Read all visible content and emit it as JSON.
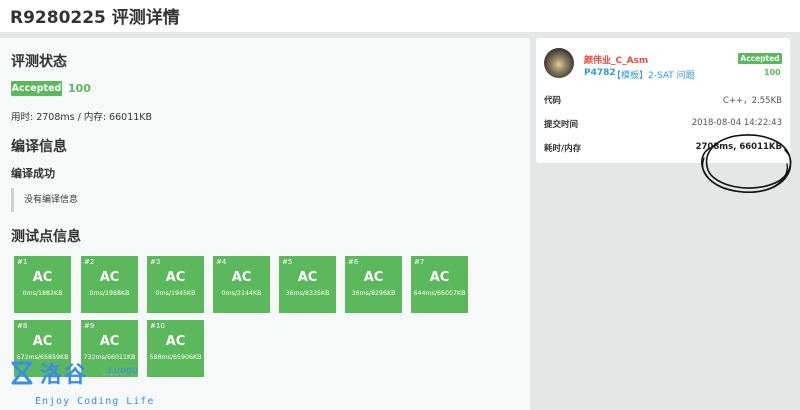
{
  "page": {
    "title": "R9280225 评测详情"
  },
  "status_section": {
    "title": "评测状态",
    "badge": "Accepted",
    "score": "100",
    "usage": "用时: 2708ms / 内存: 66011KB"
  },
  "compile_section": {
    "title": "编译信息",
    "status": "编译成功",
    "message": "没有编译信息"
  },
  "testcase_section": {
    "title": "测试点信息",
    "cases": [
      {
        "idx": "#1",
        "result": "AC",
        "meta": "0ms/1882KB"
      },
      {
        "idx": "#2",
        "result": "AC",
        "meta": "0ms/1988KB"
      },
      {
        "idx": "#3",
        "result": "AC",
        "meta": "0ms/1945KB"
      },
      {
        "idx": "#4",
        "result": "AC",
        "meta": "0ms/2144KB"
      },
      {
        "idx": "#5",
        "result": "AC",
        "meta": "36ms/8335KB"
      },
      {
        "idx": "#6",
        "result": "AC",
        "meta": "36ms/8296KB"
      },
      {
        "idx": "#7",
        "result": "AC",
        "meta": "644ms/66007KB"
      },
      {
        "idx": "#8",
        "result": "AC",
        "meta": "672ms/65859KB"
      },
      {
        "idx": "#9",
        "result": "AC",
        "meta": "732ms/66011KB"
      },
      {
        "idx": "#10",
        "result": "AC",
        "meta": "588ms/65906KB"
      }
    ]
  },
  "summary_card": {
    "username": "颜伟业_C_Asm",
    "badge": "Accepted",
    "score": "100",
    "problem_id": "P4782",
    "problem_title": "【模板】2-SAT 问题",
    "rows": [
      {
        "label": "代码",
        "value": "C++，2.55KB"
      },
      {
        "label": "提交时间",
        "value": "2018-08-04 14:22:43"
      },
      {
        "label": "耗时/内存",
        "value": "2708ms, 66011KB"
      }
    ]
  },
  "logo": {
    "cn": "洛谷",
    "en": "Luogu",
    "version": "< 3.0 >",
    "slogan": "Enjoy Coding Life"
  },
  "colors": {
    "accent_green": "#5cb85c",
    "username_red": "#e74c3c",
    "link_blue": "#3498db",
    "logo_blue": "#3a8ee6"
  }
}
